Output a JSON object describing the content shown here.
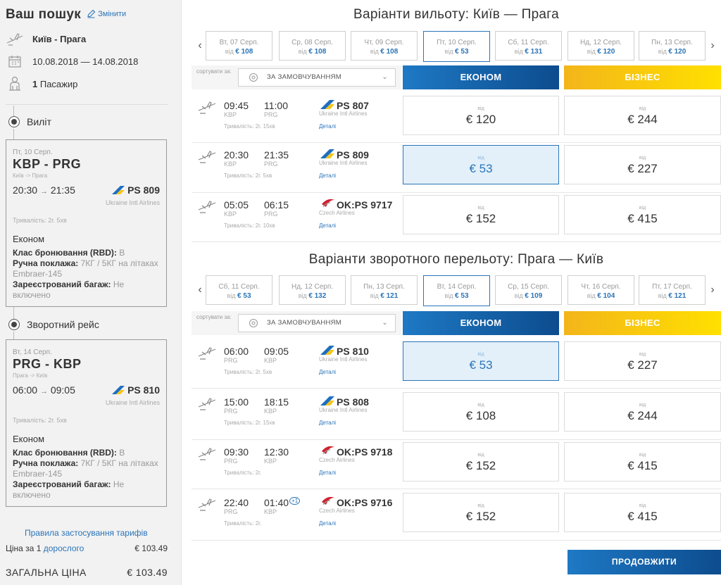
{
  "sidebar": {
    "title": "Ваш пошук",
    "change_label": "Змінити",
    "route": "Київ - Прага",
    "dates": "10.08.2018 — 14.08.2018",
    "passengers_count": "1",
    "passengers_label": "Пасажир",
    "outbound_label": "Виліт",
    "return_label": "Зворотний рейс",
    "outbound": {
      "date": "Пт, 10 Серп.",
      "route": "KBP - PRG",
      "route_sub": "Київ -> Прага",
      "dep": "20:30",
      "arr": "21:35",
      "flight": "PS 809",
      "airline": "Ukraine Intl Airlines",
      "duration": "Тривалість: 2г. 5хв",
      "cabin": "Економ",
      "rbd_label": "Клас бронювання (RBD):",
      "rbd_value": "B",
      "hand_label": "Ручна поклажа:",
      "hand_value": "7КГ / 5КГ на літаках Embraer-145",
      "bag_label": "Зареєстрований багаж:",
      "bag_value": "Не включено"
    },
    "inbound": {
      "date": "Вт, 14 Серп.",
      "route": "PRG - KBP",
      "route_sub": "Прага -> Київ",
      "dep": "06:00",
      "arr": "09:05",
      "flight": "PS 810",
      "airline": "Ukraine Intl Airlines",
      "duration": "Тривалість: 2г. 5хв",
      "cabin": "Економ",
      "rbd_label": "Клас бронювання (RBD):",
      "rbd_value": "B",
      "hand_label": "Ручна поклажа:",
      "hand_value": "7КГ / 5КГ на літаках Embraer-145",
      "bag_label": "Зареєстрований багаж:",
      "bag_value": "Не включено"
    },
    "tariff_rules": "Правила застосування тарифів",
    "price_prefix": "Ціна за 1",
    "price_link": "дорослого",
    "price_value": "€ 103.49",
    "total_label": "ЗАГАЛЬНА ЦІНА",
    "total_value": "€ 103.49"
  },
  "outbound": {
    "title": "Варіанти вильоту: Київ — Прага",
    "dates": [
      {
        "day": "Вт, 07 Серп.",
        "from": "від",
        "price": "€ 108"
      },
      {
        "day": "Ср, 08 Серп.",
        "from": "від",
        "price": "€ 108"
      },
      {
        "day": "Чт, 09 Серп.",
        "from": "від",
        "price": "€ 108"
      },
      {
        "day": "Пт, 10 Серп.",
        "from": "від",
        "price": "€ 53"
      },
      {
        "day": "Сб, 11 Серп.",
        "from": "від",
        "price": "€ 131"
      },
      {
        "day": "Нд, 12 Серп.",
        "from": "від",
        "price": "€ 120"
      },
      {
        "day": "Пн, 13 Серп.",
        "from": "від",
        "price": "€ 120"
      }
    ],
    "sort_label": "сортувати за:",
    "sort_value": "ЗА ЗАМОВЧУВАННЯМ",
    "economy": "ЕКОНОМ",
    "business": "БІЗНЕС",
    "flights": [
      {
        "dep": "09:45",
        "arr": "11:00",
        "from": "KBP",
        "to": "PRG",
        "plus": "",
        "duration": "Тривалість: 2г. 15хв",
        "flight": "PS 807",
        "airline": "Ukraine Intl Airlines",
        "details": "Деталі",
        "eco_from": "від",
        "eco_price": "€ 120",
        "biz_from": "від",
        "biz_price": "€ 244"
      },
      {
        "dep": "20:30",
        "arr": "21:35",
        "from": "KBP",
        "to": "PRG",
        "plus": "",
        "duration": "Тривалість: 2г. 5хв",
        "flight": "PS 809",
        "airline": "Ukraine Intl Airlines",
        "details": "Деталі",
        "eco_from": "від",
        "eco_price": "€ 53",
        "biz_from": "від",
        "biz_price": "€ 227"
      },
      {
        "dep": "05:05",
        "arr": "06:15",
        "from": "KBP",
        "to": "PRG",
        "plus": "",
        "duration": "Тривалість: 2г. 10хв",
        "flight": "OK:PS 9717",
        "airline": "Czech Airlines",
        "details": "Деталі",
        "eco_from": "від",
        "eco_price": "€ 152",
        "biz_from": "від",
        "biz_price": "€ 415"
      }
    ]
  },
  "inbound": {
    "title": "Варіанти зворотного перельоту: Прага — Київ",
    "dates": [
      {
        "day": "Сб, 11 Серп.",
        "from": "від",
        "price": "€ 53"
      },
      {
        "day": "Нд, 12 Серп.",
        "from": "від",
        "price": "€ 132"
      },
      {
        "day": "Пн, 13 Серп.",
        "from": "від",
        "price": "€ 121"
      },
      {
        "day": "Вт, 14 Серп.",
        "from": "від",
        "price": "€ 53"
      },
      {
        "day": "Ср, 15 Серп.",
        "from": "від",
        "price": "€ 109"
      },
      {
        "day": "Чт, 16 Серп.",
        "from": "від",
        "price": "€ 104"
      },
      {
        "day": "Пт, 17 Серп.",
        "from": "від",
        "price": "€ 121"
      }
    ],
    "sort_label": "сортувати за:",
    "sort_value": "ЗА ЗАМОВЧУВАННЯМ",
    "economy": "ЕКОНОМ",
    "business": "БІЗНЕС",
    "flights": [
      {
        "dep": "06:00",
        "arr": "09:05",
        "from": "PRG",
        "to": "KBP",
        "plus": "",
        "duration": "Тривалість: 2г. 5хв",
        "flight": "PS 810",
        "airline": "Ukraine Intl Airlines",
        "details": "Деталі",
        "eco_from": "від",
        "eco_price": "€ 53",
        "biz_from": "від",
        "biz_price": "€ 227"
      },
      {
        "dep": "15:00",
        "arr": "18:15",
        "from": "PRG",
        "to": "KBP",
        "plus": "",
        "duration": "Тривалість: 2г. 15хв",
        "flight": "PS 808",
        "airline": "Ukraine Intl Airlines",
        "details": "Деталі",
        "eco_from": "від",
        "eco_price": "€ 108",
        "biz_from": "від",
        "biz_price": "€ 244"
      },
      {
        "dep": "09:30",
        "arr": "12:30",
        "from": "PRG",
        "to": "KBP",
        "plus": "",
        "duration": "Тривалість: 2г.",
        "flight": "OK:PS 9718",
        "airline": "Czech Airlines",
        "details": "Деталі",
        "eco_from": "від",
        "eco_price": "€ 152",
        "biz_from": "від",
        "biz_price": "€ 415"
      },
      {
        "dep": "22:40",
        "arr": "01:40",
        "from": "PRG",
        "to": "KBP",
        "plus": "+1",
        "duration": "Тривалість: 2г.",
        "flight": "OK:PS 9716",
        "airline": "Czech Airlines",
        "details": "Деталі",
        "eco_from": "від",
        "eco_price": "€ 152",
        "biz_from": "від",
        "biz_price": "€ 415"
      }
    ]
  },
  "continue_label": "ПРОДОВЖИТИ",
  "colors": {
    "accent": "#2a74b8",
    "economy": "#1667b0",
    "business": "#f7c50f",
    "selected_bg": "#e3f0fa"
  }
}
